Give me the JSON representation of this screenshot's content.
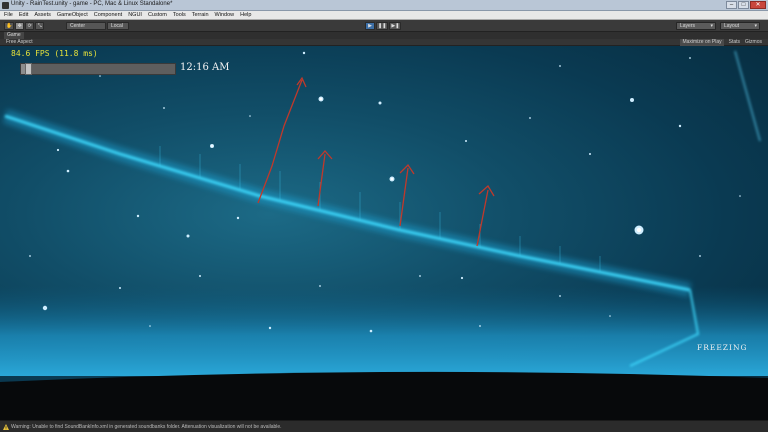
{
  "window": {
    "title": "Unity - RainTest.unity - game - PC, Mac & Linux Standalone*",
    "minimize": "–",
    "maximize": "□",
    "close": "✕"
  },
  "menu": [
    "File",
    "Edit",
    "Assets",
    "GameObject",
    "Component",
    "NGUI",
    "Custom",
    "Tools",
    "Terrain",
    "Window",
    "Help"
  ],
  "toolbar": {
    "pivot_label": "Center",
    "space_label": "Local",
    "layers_label": "Layers",
    "layout_label": "Layout"
  },
  "game_tab": {
    "label": "Game",
    "aspect_label": "Free Aspect",
    "maximize_label": "Maximize on Play",
    "stats_label": "Stats",
    "gizmos_label": "Gizmos"
  },
  "hud": {
    "fps": "84.6 FPS (11.8 ms)",
    "time_value": 0.03,
    "clock": "12:16 AM",
    "weather": "FREEZING"
  },
  "status": {
    "message": "Warning: Unable to find SoundBankInfo.xml in generated soundbanks folder. Attenuation visualization will not be available."
  },
  "colors": {
    "accent_yellow": "#e8e23a",
    "streak_cyan": "#2fd0ff",
    "annotation_red": "#c0392b"
  }
}
